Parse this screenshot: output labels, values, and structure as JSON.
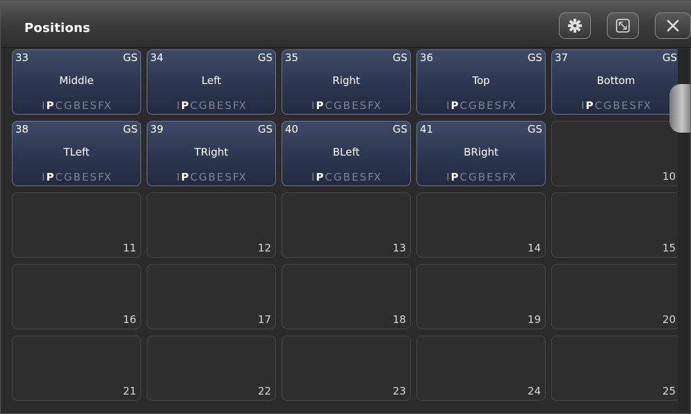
{
  "window": {
    "title": "Positions",
    "buttons": [
      {
        "name": "settings-button",
        "icon": "gear-icon"
      },
      {
        "name": "restore-button",
        "icon": "restore-window-icon"
      },
      {
        "name": "close-button",
        "icon": "close-icon"
      }
    ]
  },
  "colors": {
    "filled_tile_top": "#3f4a66",
    "filled_tile_bottom": "#232b40",
    "empty_tile": "#2e2e2e",
    "active_attr": "#ffffff",
    "inactive_attr": "#7d8295"
  },
  "tiles": [
    {
      "number": "33",
      "gs": "GS",
      "name": "Middle",
      "attrs": [
        "I",
        "P",
        "C",
        "G",
        "B",
        "E",
        "S",
        "FX"
      ],
      "active": [
        "P"
      ]
    },
    {
      "number": "34",
      "gs": "GS",
      "name": "Left",
      "attrs": [
        "I",
        "P",
        "C",
        "G",
        "B",
        "E",
        "S",
        "FX"
      ],
      "active": [
        "P"
      ]
    },
    {
      "number": "35",
      "gs": "GS",
      "name": "Right",
      "attrs": [
        "I",
        "P",
        "C",
        "G",
        "B",
        "E",
        "S",
        "FX"
      ],
      "active": [
        "P"
      ]
    },
    {
      "number": "36",
      "gs": "GS",
      "name": "Top",
      "attrs": [
        "I",
        "P",
        "C",
        "G",
        "B",
        "E",
        "S",
        "FX"
      ],
      "active": [
        "P"
      ]
    },
    {
      "number": "37",
      "gs": "GS",
      "name": "Bottom",
      "attrs": [
        "I",
        "P",
        "C",
        "G",
        "B",
        "E",
        "S",
        "FX"
      ],
      "active": [
        "P"
      ]
    },
    {
      "number": "38",
      "gs": "GS",
      "name": "TLeft",
      "attrs": [
        "I",
        "P",
        "C",
        "G",
        "B",
        "E",
        "S",
        "FX"
      ],
      "active": [
        "P"
      ]
    },
    {
      "number": "39",
      "gs": "GS",
      "name": "TRight",
      "attrs": [
        "I",
        "P",
        "C",
        "G",
        "B",
        "E",
        "S",
        "FX"
      ],
      "active": [
        "P"
      ]
    },
    {
      "number": "40",
      "gs": "GS",
      "name": "BLeft",
      "attrs": [
        "I",
        "P",
        "C",
        "G",
        "B",
        "E",
        "S",
        "FX"
      ],
      "active": [
        "P"
      ]
    },
    {
      "number": "41",
      "gs": "GS",
      "name": "BRight",
      "attrs": [
        "I",
        "P",
        "C",
        "G",
        "B",
        "E",
        "S",
        "FX"
      ],
      "active": [
        "P"
      ]
    },
    {
      "slot": "10"
    },
    {
      "slot": "11"
    },
    {
      "slot": "12"
    },
    {
      "slot": "13"
    },
    {
      "slot": "14"
    },
    {
      "slot": "15"
    },
    {
      "slot": "16"
    },
    {
      "slot": "17"
    },
    {
      "slot": "18"
    },
    {
      "slot": "19"
    },
    {
      "slot": "20"
    },
    {
      "slot": "21"
    },
    {
      "slot": "22"
    },
    {
      "slot": "23"
    },
    {
      "slot": "24"
    },
    {
      "slot": "25"
    }
  ]
}
